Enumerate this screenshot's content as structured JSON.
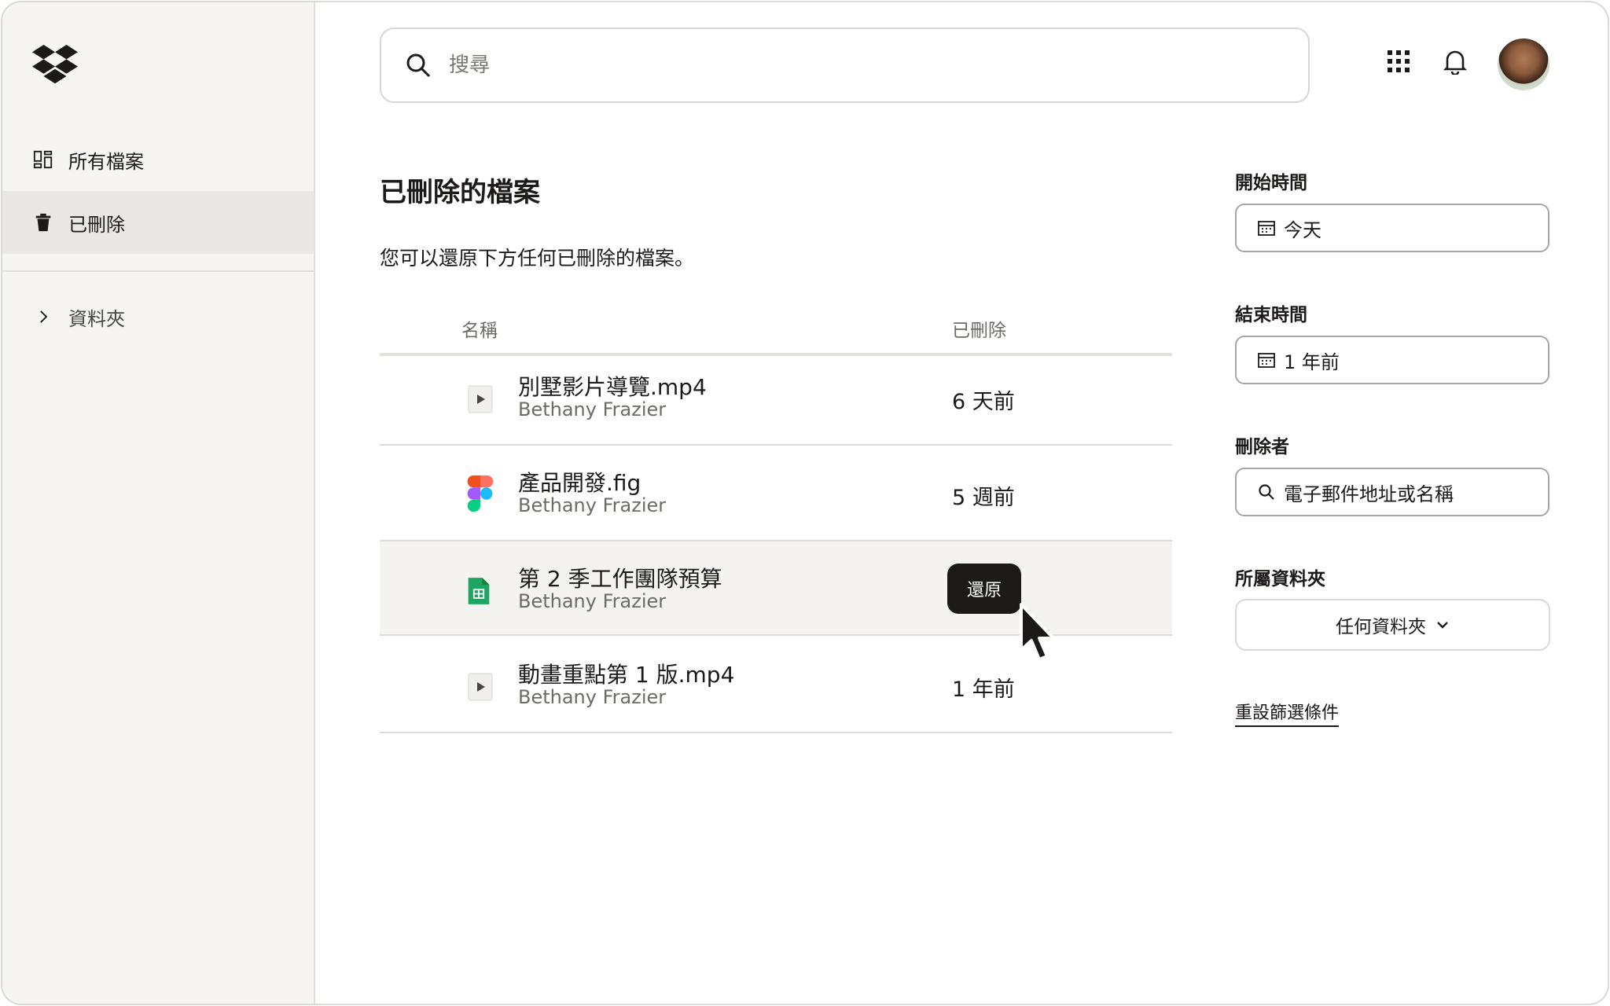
{
  "sidebar": {
    "items": [
      {
        "label": "所有檔案",
        "icon": "grid-icon"
      },
      {
        "label": "已刪除",
        "icon": "trash-icon"
      },
      {
        "label": "資料夾",
        "icon": "chevron-right-icon"
      }
    ]
  },
  "search": {
    "placeholder": "搜尋"
  },
  "main": {
    "title": "已刪除的檔案",
    "subtitle": "您可以還原下方任何已刪除的檔案。",
    "columns": {
      "name": "名稱",
      "deleted": "已刪除"
    },
    "rows": [
      {
        "name": "別墅影片導覽.mp4",
        "owner": "Bethany Frazier",
        "when": "6 天前",
        "icon": "video-file-icon"
      },
      {
        "name": "產品開發.fig",
        "owner": "Bethany Frazier",
        "when": "5 週前",
        "icon": "figma-file-icon"
      },
      {
        "name": "第 2 季工作團隊預算",
        "owner": "Bethany Frazier",
        "action": "還原",
        "icon": "sheets-file-icon"
      },
      {
        "name": "動畫重點第 1 版.mp4",
        "owner": "Bethany Frazier",
        "when": "1 年前",
        "icon": "video-file-icon"
      }
    ]
  },
  "filters": {
    "start_label": "開始時間",
    "start_value": "今天",
    "end_label": "結束時間",
    "end_value": "1 年前",
    "deleter_label": "刪除者",
    "deleter_placeholder": "電子郵件地址或名稱",
    "folder_label": "所屬資料夾",
    "folder_value": "任何資料夾",
    "reset_label": "重設篩選條件"
  },
  "colors": {
    "accent_dark": "#1e1919",
    "sidebar_bg": "#f6f5f2",
    "sheets_green": "#1fa463"
  }
}
